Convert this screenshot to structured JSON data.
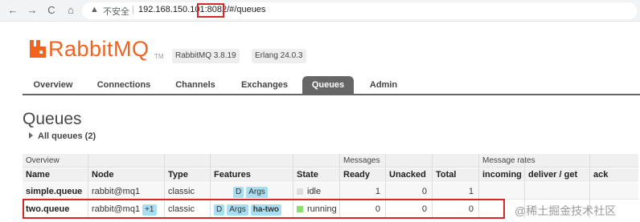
{
  "browser": {
    "back_icon": "←",
    "forward_icon": "→",
    "reload_icon": "C",
    "home_icon": "⌂",
    "warning_icon": "▲",
    "insecure_label": "不安全",
    "separator": "|",
    "url": "192.168.150.101:8082/#/queues"
  },
  "header": {
    "logo_text": "RabbitMQ",
    "logo_tm": "TM",
    "version": "RabbitMQ 3.8.19",
    "erlang": "Erlang 24.0.3",
    "brand_color": "#f26322"
  },
  "tabs": [
    {
      "label": "Overview",
      "active": false
    },
    {
      "label": "Connections",
      "active": false
    },
    {
      "label": "Channels",
      "active": false
    },
    {
      "label": "Exchanges",
      "active": false
    },
    {
      "label": "Queues",
      "active": true
    },
    {
      "label": "Admin",
      "active": false
    }
  ],
  "page": {
    "title": "Queues",
    "all_queues": "All queues (2)"
  },
  "table": {
    "groups": {
      "overview": "Overview",
      "messages": "Messages",
      "rates": "Message rates"
    },
    "headers": [
      "Name",
      "Node",
      "Type",
      "Features",
      "State",
      "Ready",
      "Unacked",
      "Total",
      "incoming",
      "deliver / get",
      "ack"
    ],
    "rows": [
      {
        "name": "simple.queue",
        "node": "rabbit@mq1",
        "node_extra": "",
        "type": "classic",
        "features": [
          "D",
          "Args"
        ],
        "state": "idle",
        "ready": "1",
        "unacked": "0",
        "total": "1"
      },
      {
        "name": "two.queue",
        "node": "rabbit@mq1",
        "node_extra": "+1",
        "type": "classic",
        "features": [
          "D",
          "Args",
          "ha-two"
        ],
        "state": "running",
        "ready": "0",
        "unacked": "0",
        "total": "0"
      }
    ]
  },
  "watermark": "@稀土掘金技术社区",
  "colors": {
    "highlight": "#d8262a",
    "running": "#8ade6e",
    "idle": "#dddddd",
    "tag": "#aaddf0"
  }
}
